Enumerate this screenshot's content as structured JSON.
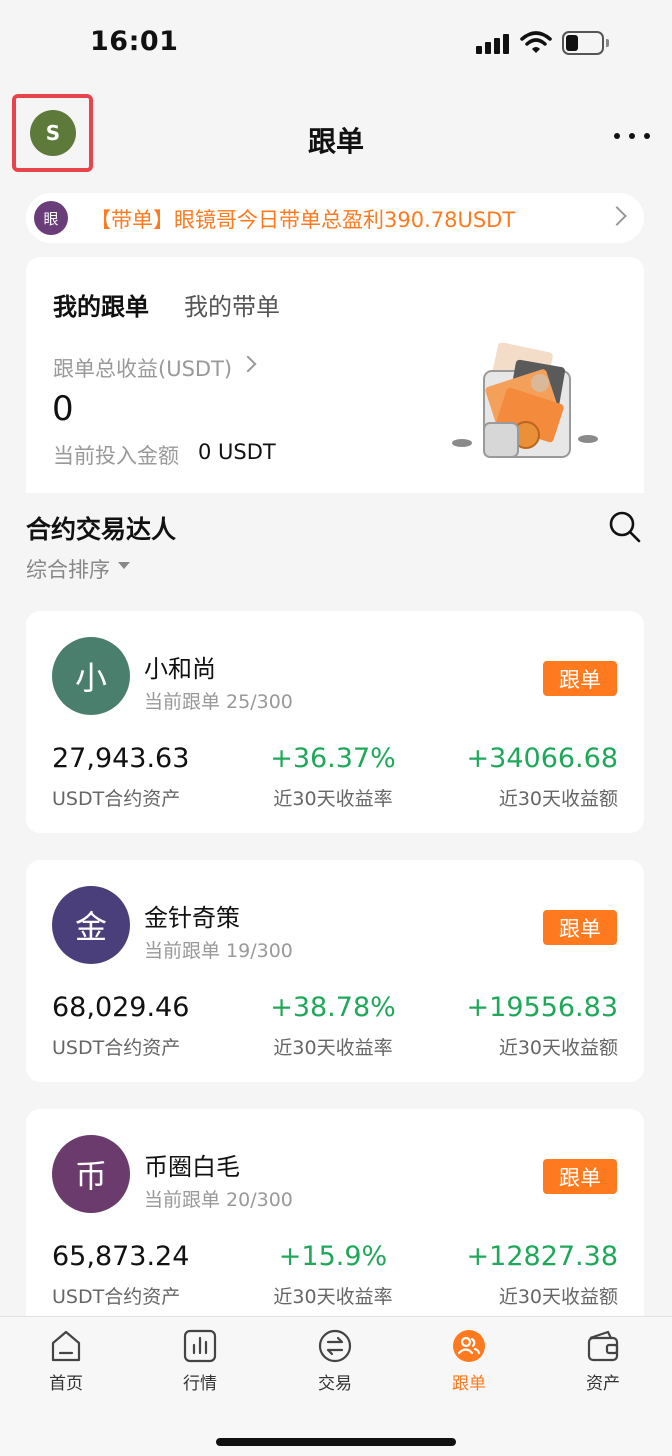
{
  "status_bar": {
    "time": "16:01"
  },
  "header": {
    "avatar_letter": "S",
    "title": "跟单"
  },
  "announcement": {
    "badge": "眼",
    "text": "【带单】眼镜哥今日带单总盈利390.78USDT"
  },
  "summary": {
    "tabs": [
      "我的跟单",
      "我的带单"
    ],
    "profit_label": "跟单总收益(USDT)",
    "profit_value": "0",
    "invest_label": "当前投入金额",
    "invest_value": "0 USDT"
  },
  "section": {
    "title": "合约交易达人",
    "sort_label": "综合排序"
  },
  "traders": [
    {
      "avatar": "小",
      "avatar_color": "#4a7f6e",
      "name": "小和尚",
      "sub": "当前跟单 25/300",
      "follow_label": "跟单",
      "asset": "27,943.63",
      "asset_label": "USDT合约资产",
      "rate": "+36.37%",
      "rate_label": "近30天收益率",
      "amount": "+34066.68",
      "amount_label": "近30天收益额"
    },
    {
      "avatar": "金",
      "avatar_color": "#4a3f7a",
      "name": "金针奇策",
      "sub": "当前跟单 19/300",
      "follow_label": "跟单",
      "asset": "68,029.46",
      "asset_label": "USDT合约资产",
      "rate": "+38.78%",
      "rate_label": "近30天收益率",
      "amount": "+19556.83",
      "amount_label": "近30天收益额"
    },
    {
      "avatar": "币",
      "avatar_color": "#6b3b6e",
      "name": "币圈白毛",
      "sub": "当前跟单 20/300",
      "follow_label": "跟单",
      "asset": "65,873.24",
      "asset_label": "USDT合约资产",
      "rate": "+15.9%",
      "rate_label": "近30天收益率",
      "amount": "+12827.38",
      "amount_label": "近30天收益额"
    }
  ],
  "tab_bar": {
    "items": [
      {
        "label": "首页",
        "icon": "home-icon"
      },
      {
        "label": "行情",
        "icon": "chart-icon"
      },
      {
        "label": "交易",
        "icon": "exchange-icon"
      },
      {
        "label": "跟单",
        "icon": "copy-trade-icon",
        "active": true
      },
      {
        "label": "资产",
        "icon": "wallet-icon"
      }
    ]
  },
  "colors": {
    "accent": "#ff7a1f",
    "positive": "#1fa85a",
    "highlight_border": "#e8454a"
  }
}
